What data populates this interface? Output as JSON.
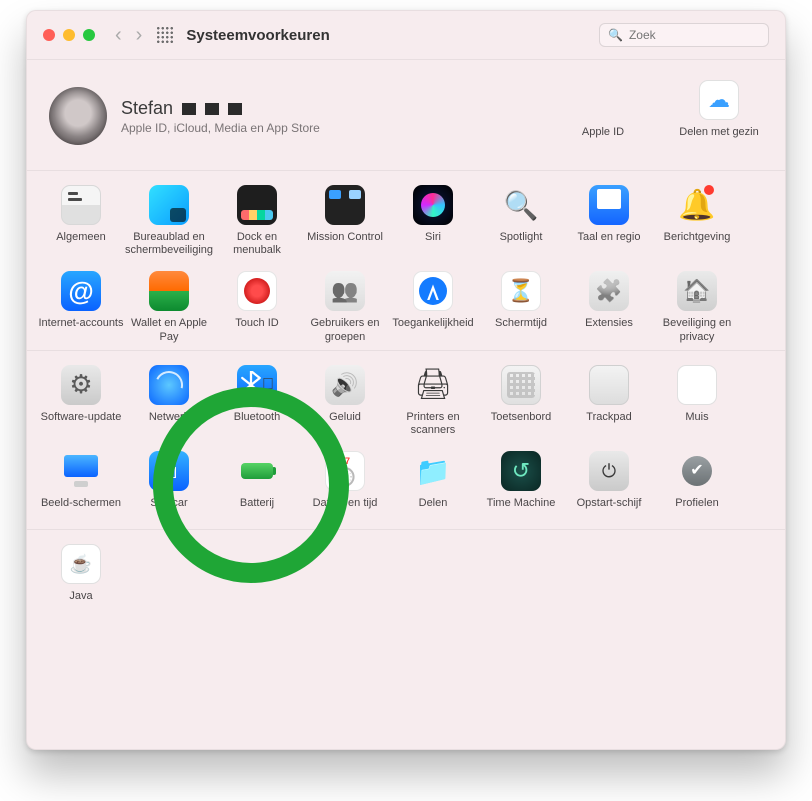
{
  "toolbar": {
    "title": "Systeemvoorkeuren",
    "search_placeholder": "Zoek"
  },
  "profile": {
    "name": "Stefan",
    "subtitle": "Apple ID, iCloud, Media en App Store",
    "side": [
      {
        "key": "apple_id",
        "label": "Apple ID"
      },
      {
        "key": "family",
        "label": "Delen met gezin"
      }
    ]
  },
  "sections": [
    [
      {
        "key": "general",
        "label": "Algemeen"
      },
      {
        "key": "desktop",
        "label": "Bureaublad en schermbeveiliging"
      },
      {
        "key": "dock",
        "label": "Dock en menubalk"
      },
      {
        "key": "mission",
        "label": "Mission Control"
      },
      {
        "key": "siri",
        "label": "Siri"
      },
      {
        "key": "spotlight",
        "label": "Spotlight"
      },
      {
        "key": "language",
        "label": "Taal en regio"
      },
      {
        "key": "notify",
        "label": "Berichtgeving"
      },
      {
        "key": "internet",
        "label": "Internet-accounts"
      },
      {
        "key": "wallet",
        "label": "Wallet en Apple Pay"
      },
      {
        "key": "touchid",
        "label": "Touch ID"
      },
      {
        "key": "users",
        "label": "Gebruikers en groepen"
      },
      {
        "key": "access",
        "label": "Toegankelijkheid"
      },
      {
        "key": "screentime",
        "label": "Schermtijd"
      },
      {
        "key": "ext",
        "label": "Extensies"
      },
      {
        "key": "security",
        "label": "Beveiliging en privacy"
      }
    ],
    [
      {
        "key": "swupdate",
        "label": "Software-update"
      },
      {
        "key": "network",
        "label": "Netwerk"
      },
      {
        "key": "bluetooth",
        "label": "Bluetooth"
      },
      {
        "key": "sound",
        "label": "Geluid"
      },
      {
        "key": "printers",
        "label": "Printers en scanners"
      },
      {
        "key": "keyboard",
        "label": "Toetsenbord"
      },
      {
        "key": "trackpad",
        "label": "Trackpad"
      },
      {
        "key": "mouse",
        "label": "Muis"
      },
      {
        "key": "displays",
        "label": "Beeld-schermen"
      },
      {
        "key": "sidecar",
        "label": "Sidecar"
      },
      {
        "key": "battery",
        "label": "Batterij"
      },
      {
        "key": "datetime",
        "label": "Datum en tijd"
      },
      {
        "key": "share",
        "label": "Delen"
      },
      {
        "key": "timemachine",
        "label": "Time Machine"
      },
      {
        "key": "startup",
        "label": "Opstart-schijf"
      },
      {
        "key": "profiles",
        "label": "Profielen"
      }
    ],
    [
      {
        "key": "java",
        "label": "Java"
      }
    ]
  ],
  "highlight": "bluetooth"
}
